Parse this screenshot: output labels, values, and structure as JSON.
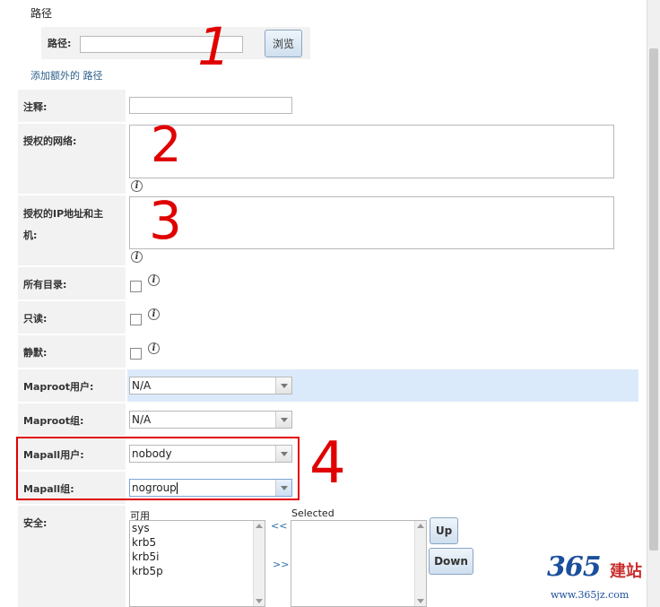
{
  "section_title": "路径",
  "path": {
    "label": "路径:",
    "value": "",
    "browse_label": "浏览",
    "add_link": "添加额外的 路径"
  },
  "comment": {
    "label": "注释:",
    "value": ""
  },
  "auth_networks": {
    "label": "授权的网络:",
    "value": ""
  },
  "auth_hosts": {
    "label_line1": "授权的IP地址和主",
    "label_line2": "机:",
    "value": ""
  },
  "all_dirs": {
    "label": "所有目录:",
    "checked": false
  },
  "read_only": {
    "label": "只读:",
    "checked": false
  },
  "quiet": {
    "label": "静默:",
    "checked": false
  },
  "maproot_user": {
    "label": "Maproot用户:",
    "value": "N/A"
  },
  "maproot_group": {
    "label": "Maproot组:",
    "value": "N/A"
  },
  "mapall_user": {
    "label": "Mapall用户:",
    "value": "nobody"
  },
  "mapall_group": {
    "label": "Mapall组:",
    "value": "nogroup"
  },
  "security": {
    "label": "安全:",
    "available_label": "可用",
    "available": [
      "sys",
      "krb5",
      "krb5i",
      "krb5p"
    ],
    "selected_label": "Selected",
    "selected": [],
    "add_all": "<<",
    "remove_all": ">>",
    "up_label": "Up",
    "down_label": "Down"
  },
  "annotations": [
    "1",
    "2",
    "3",
    "4"
  ],
  "annotation_color": "#e00000",
  "highlight_row_color": "#dbeafa",
  "watermark": {
    "brand": "365",
    "brand_cn": "建站",
    "url": "www.365jz.com"
  }
}
